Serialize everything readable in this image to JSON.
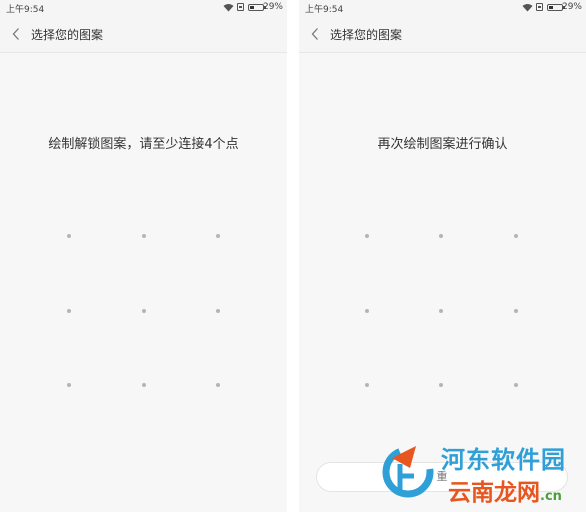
{
  "status_bar": {
    "time": "上午9:54",
    "battery_percent": "29%"
  },
  "header": {
    "title": "选择您的图案"
  },
  "left_screen": {
    "prompt": "绘制解锁图案，请至少连接4个点"
  },
  "right_screen": {
    "prompt": "再次绘制图案进行确认",
    "button_label_visible": "重"
  },
  "watermark": {
    "line1": "河东软件园",
    "line2_main": "云南龙网",
    "line2_suffix": ".cn"
  },
  "colors": {
    "background": "#f7f7f7",
    "dot": "#b5b5b5",
    "watermark_blue": "#2f9fd8",
    "watermark_orange": "#e8561f"
  }
}
